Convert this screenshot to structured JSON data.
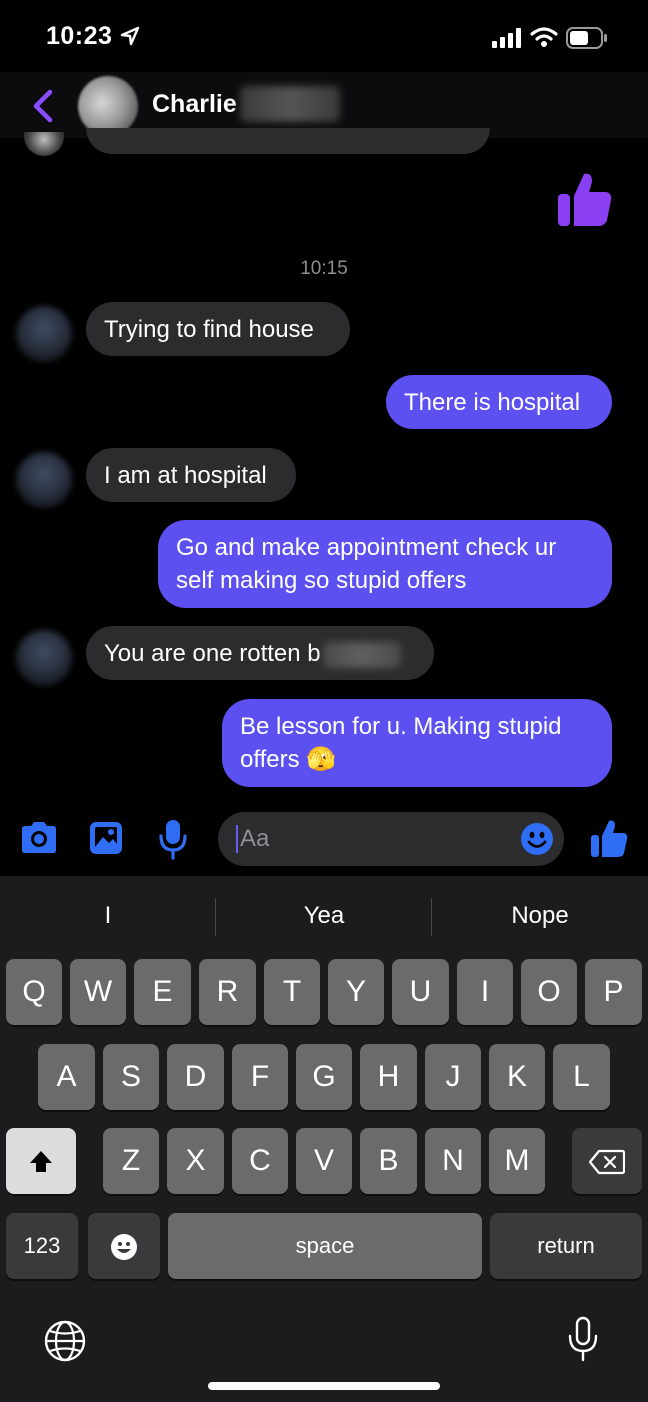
{
  "status_bar": {
    "time": "10:23"
  },
  "header": {
    "contact_name": "Charlie"
  },
  "conversation": {
    "timestamp": "10:15",
    "messages": [
      {
        "from": "them",
        "text": "Trying to find house"
      },
      {
        "from": "me",
        "text": "There is hospital"
      },
      {
        "from": "them",
        "text": "I am at hospital"
      },
      {
        "from": "me",
        "text": "Go and make appointment check ur self making so stupid offers"
      },
      {
        "from": "them",
        "text": "You are one rotten b"
      },
      {
        "from": "me",
        "text": "Be lesson for u. Making stupid offers",
        "emoji": "🫣"
      }
    ]
  },
  "composer": {
    "placeholder": "Aa"
  },
  "keyboard": {
    "suggestions": [
      "I",
      "Yea",
      "Nope"
    ],
    "row1": [
      "Q",
      "W",
      "E",
      "R",
      "T",
      "Y",
      "U",
      "I",
      "O",
      "P"
    ],
    "row2": [
      "A",
      "S",
      "D",
      "F",
      "G",
      "H",
      "J",
      "K",
      "L"
    ],
    "row3": [
      "Z",
      "X",
      "C",
      "V",
      "B",
      "N",
      "M"
    ],
    "numbers_label": "123",
    "space_label": "space",
    "return_label": "return"
  },
  "colors": {
    "accent": "#5c50f0",
    "icon": "#2f6df5",
    "back": "#8a4dff"
  }
}
